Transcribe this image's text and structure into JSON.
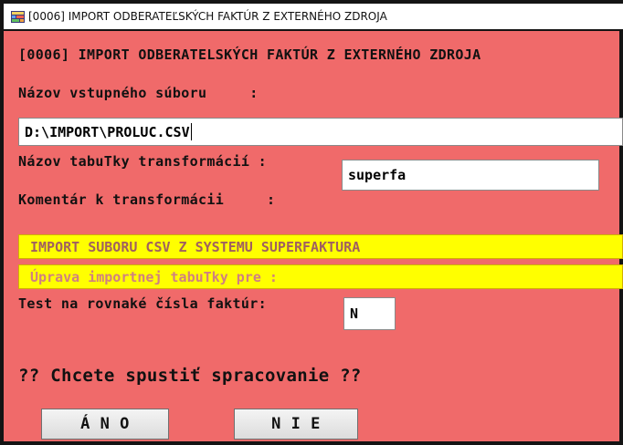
{
  "window": {
    "title": "[0006] IMPORT ODBERATEĽSKÝCH FAKTÚR Z EXTERNÉHO ZDROJA"
  },
  "form": {
    "heading": "[0006] IMPORT ODBERATELSKÝCH FAKTÚR Z EXTERNÉHO ZDROJA",
    "input_file_label": "Názov vstupného súboru     :",
    "input_file_value": "D:\\IMPORT\\PROLUC.CSV",
    "table_label": "Názov tabuTky transformácií :",
    "table_value": "superfa",
    "comment_label": "Komentár k transformácii     :",
    "comment_line1": "IMPORT SUBORU CSV Z SYSTEMU SUPERFAKTURA",
    "comment_line2": "Úprava importnej tabuTky pre :",
    "test_label": "Test na rovnaké čísla faktúr:",
    "test_value": "N",
    "question": "?? Chcete spustiť spracovanie ??"
  },
  "buttons": {
    "yes": "Á N O",
    "no": "N I E"
  },
  "colors": {
    "background": "#f06a6a",
    "highlight": "#ffff00"
  },
  "icons": {
    "title": "app-database-icon"
  }
}
